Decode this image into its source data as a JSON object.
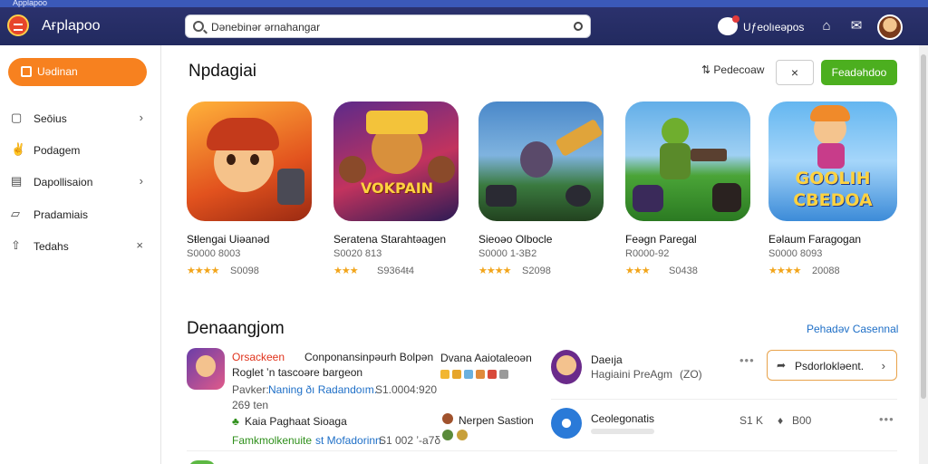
{
  "window": {
    "strip_text": "Applapoo",
    "app_title": "Ағplapoo"
  },
  "search": {
    "value": "Dənebinər ərnahangar"
  },
  "header": {
    "user_label": "Uƒeolıeəpos"
  },
  "sidebar": {
    "active": {
      "label": "Uədinan"
    },
    "items": [
      {
        "label": "Seōius",
        "icon": "window-icon",
        "has_chevron": true,
        "chevron": "›"
      },
      {
        "label": "Podagem",
        "icon": "thumbs-up-icon",
        "has_chevron": false
      },
      {
        "label": "Dapollisaion",
        "icon": "document-icon",
        "has_chevron": true,
        "chevron": "›"
      },
      {
        "label": "Pradamiais",
        "icon": "folder-icon",
        "has_chevron": false
      },
      {
        "label": "Tedahs",
        "icon": "upload-icon",
        "has_chevron": true,
        "chevron": "×"
      }
    ]
  },
  "featured": {
    "title": "Npdagiai",
    "sort_label": "Pedecoaw",
    "close_label": "×",
    "primary_label": "Feadəhdoo",
    "cards": [
      {
        "name": "Sŧlengai Uiəanəd",
        "sub": "S0000 8003",
        "stars": "★★★★",
        "rating": "S0098"
      },
      {
        "name": "Seratena Starahtəagen",
        "sub": "S0020 813",
        "stars": "★★★",
        "rating": "S9364ŧ4"
      },
      {
        "name": "Sieoəo Olbocle",
        "sub": "S0000 1-3B2",
        "stars": "★★★★",
        "rating": "S2098"
      },
      {
        "name": "Feəgn Paregal",
        "sub": "R0000-92",
        "stars": "★★★",
        "rating": "S0438"
      },
      {
        "name": "Eəlaum Faragogan",
        "sub": "S0000 8093",
        "stars": "★★★★",
        "rating": "20088"
      }
    ],
    "banners": {
      "card2": "VOKPAIN",
      "card5_line1": "GOOLIH",
      "card5_line2": "CBEDOA"
    }
  },
  "list": {
    "title": "Denaangjom",
    "see_all": "Pehadəv Casennal",
    "row1": {
      "title_red": "Orsackeen",
      "title_rest": "Conponansinpəurh Bolpən",
      "line2": "Roglet ʼn tascoəre bargeon",
      "line3_prefix": "Pavker:",
      "line3_link": "Naning ðı Radandoım.",
      "line3_suffix": "S1.0004:920",
      "line4": "269 ten",
      "line5": "Kaia Paghaat Sioaga",
      "line6_green": "Famkmolkenuite",
      "line6_blue": "st Mofadorinn.",
      "line6_suffix": "S1 002 ʼ-a7δ",
      "mid_title": "Dvana Aaiotaleoən",
      "mid_bottom": "Nerpen Sastion",
      "right_title": "Daeıja",
      "right_sub": "Hagiaini PreAgm",
      "right_count": "(ZO)",
      "dots": "•••",
      "button_label": "Psdorlokləent."
    },
    "row2": {
      "title": "Ceolegonatis",
      "stat1": "S1 K",
      "stat2": "B00",
      "dots": "•••"
    }
  },
  "colors": {
    "accent": "#f7811f",
    "primary": "#4caf1f",
    "topbar": "#262c64",
    "link": "#1e6fc7"
  }
}
